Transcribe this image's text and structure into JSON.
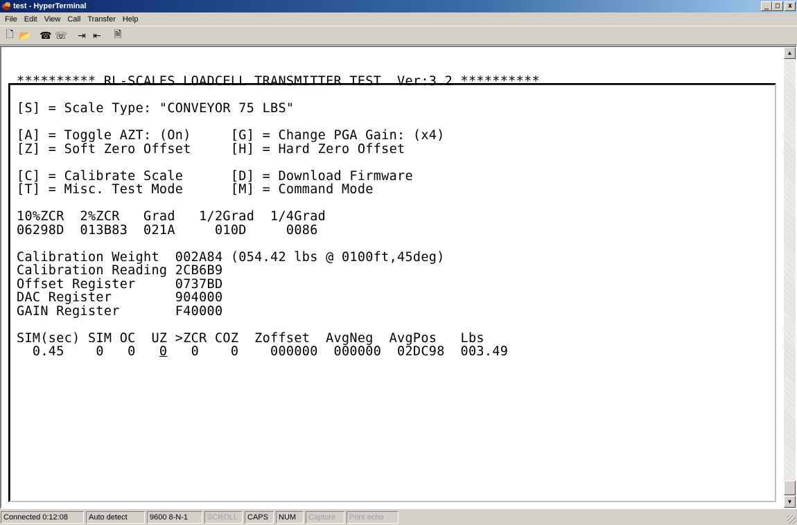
{
  "window": {
    "title": "test - HyperTerminal",
    "controls": [
      "_",
      "□",
      "x"
    ]
  },
  "menu": [
    "File",
    "Edit",
    "View",
    "Call",
    "Transfer",
    "Help"
  ],
  "toolbar": {
    "buttons": [
      {
        "icon": "new-icon",
        "glyph": "🗋"
      },
      {
        "icon": "open-icon",
        "glyph": "📂"
      },
      {
        "icon": "connect-icon",
        "glyph": "☎"
      },
      {
        "icon": "disconnect-icon",
        "glyph": "☏"
      },
      {
        "icon": "send-icon",
        "glyph": "⇥"
      },
      {
        "icon": "receive-icon",
        "glyph": "⇤"
      },
      {
        "icon": "properties-icon",
        "glyph": "🗎"
      }
    ]
  },
  "terminal": {
    "lines": [
      "********** RL-SCALES LOADCELL TRANSMITTER TEST  Ver:3.2 **********",
      "",
      "[S] = Scale Type: \"CONVEYOR 75 LBS\"",
      "",
      "[A] = Toggle AZT: (On)     [G] = Change PGA Gain: (x4)",
      "[Z] = Soft Zero Offset     [H] = Hard Zero Offset",
      "",
      "[C] = Calibrate Scale      [D] = Download Firmware",
      "[T] = Misc. Test Mode      [M] = Command Mode",
      "",
      "10%ZCR  2%ZCR   Grad   1/2Grad  1/4Grad",
      "06298D  013B83  021A     010D     0086",
      "",
      "Calibration Weight  002A84 (054.42 lbs @ 0100ft,45deg)",
      "Calibration Reading 2CB6B9",
      "Offset Register     0737BD",
      "DAC Register        904000",
      "GAIN Register       F40000",
      "",
      "SIM(sec) SIM OC  UZ >ZCR COZ  Zoffset  AvgNeg  AvgPos   Lbs"
    ],
    "last_line": {
      "before": "  0.45    0   0   ",
      "cursor": "0",
      "after": "   0    0    000000  000000  02DC98  003.49"
    }
  },
  "status": [
    {
      "text": "Connected 0:12:08",
      "dim": false
    },
    {
      "text": "Auto detect",
      "dim": false
    },
    {
      "text": "9600 8-N-1",
      "dim": false
    },
    {
      "text": "SCROLL",
      "dim": true
    },
    {
      "text": "CAPS",
      "dim": false
    },
    {
      "text": "NUM",
      "dim": false
    },
    {
      "text": "Capture",
      "dim": true
    },
    {
      "text": "Print echo",
      "dim": true
    }
  ]
}
